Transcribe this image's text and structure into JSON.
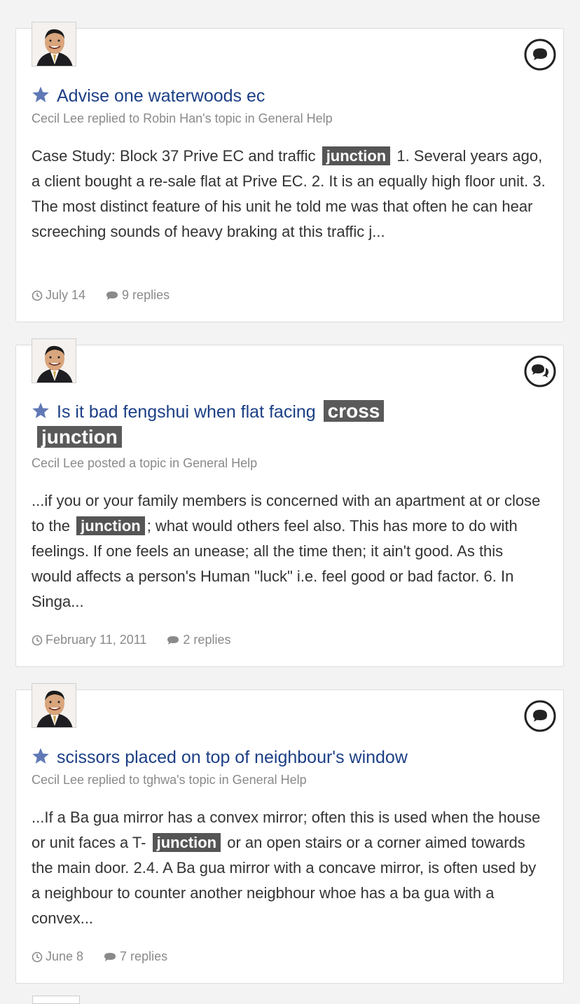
{
  "results": [
    {
      "title": "Advise one waterwoods ec",
      "meta": "Cecil Lee replied to Robin Han's topic in General Help",
      "snippet_before": "Case Study: Block 37 Prive EC and traffic ",
      "highlight": "junction",
      "snippet_after": " 1. Several years ago, a client bought a re-sale flat at Prive EC. 2. It is an equally high floor unit. 3. The most distinct feature of his unit he told me was that often he can hear screeching sounds of heavy braking at this traffic j...",
      "date": "July 14",
      "replies": "9 replies",
      "icon": "comment-icon"
    },
    {
      "title_before": "Is it bad fengshui when flat facing ",
      "title_hl1": "cross",
      "title_hl2": "junction",
      "meta": "Cecil Lee posted a topic in General Help",
      "snippet_before": "...if you or your family members is concerned with an apartment at or close to the ",
      "highlight": "junction",
      "snippet_after": "; what would others feel also. This has more to do with feelings. If one feels an unease; all the time then; it ain't good. As this would affects a person's Human \"luck\" i.e. feel good or bad factor. 6. In Singa...",
      "date": "February 11, 2011",
      "replies": "2 replies",
      "icon": "comments-icon"
    },
    {
      "title": "scissors placed on top of neighbour's window",
      "meta": "Cecil Lee replied to tghwa's topic in General Help",
      "snippet_before": "...If a Ba gua mirror has a convex mirror; often this is used when the house or unit faces a T- ",
      "highlight": "junction",
      "snippet_after": " or an open stairs or a corner aimed towards the main door. 2.4. A Ba gua mirror with a concave mirror, is often used by a neighbour to counter another neigbhour whoe has a ba gua with a convex...",
      "date": "June 8",
      "replies": "7 replies",
      "icon": "comment-icon"
    }
  ],
  "colors": {
    "title": "#1c3f86",
    "star": "#6079b5",
    "highlight_bg": "#555555",
    "meta": "#8a8a8a"
  }
}
